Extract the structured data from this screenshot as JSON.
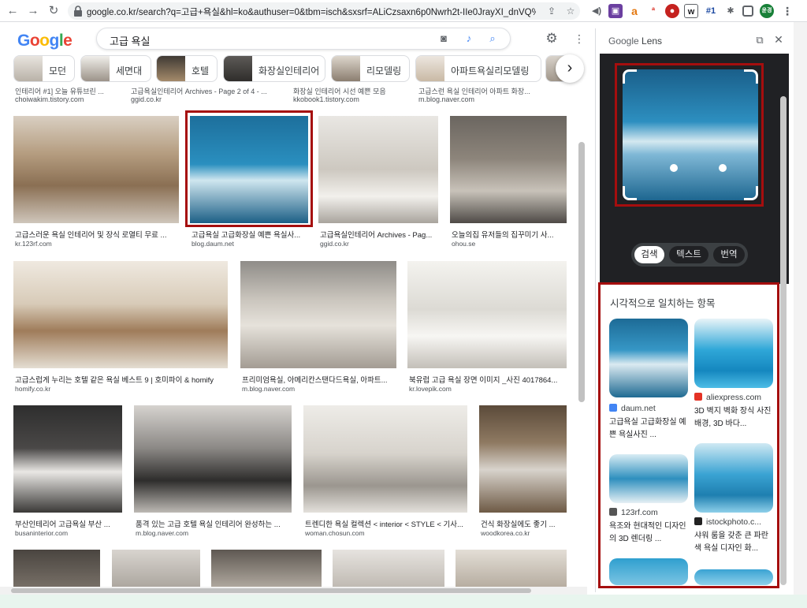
{
  "browser": {
    "url": "google.co.kr/search?q=고급+욕실&hl=ko&authuser=0&tbm=isch&sxsrf=ALiCzsaxn6p0Nwrh2t-IIe0JrayXI_dnVQ%3A16...",
    "ext_badge": "#1",
    "profile_label": "윤경"
  },
  "google": {
    "logo": "Google",
    "query": "고급 욕실",
    "chips": [
      {
        "label": "모던"
      },
      {
        "label": "세면대"
      },
      {
        "label": "호텔"
      },
      {
        "label": "화장실인테리어"
      },
      {
        "label": "리모델링"
      },
      {
        "label": "아파트욕실리모델링"
      }
    ],
    "top_row_captions": [
      {
        "caption": "인테리어 #1] 오늘 유튜브린 ...",
        "source": "choiwakim.tistory.com"
      },
      {
        "caption": "고급욕실인테리어 Archives - Page 2 of 4 - ...",
        "source": "ggid.co.kr"
      },
      {
        "caption": "화장실 인테리어 시선 예쁜 모음",
        "source": "kkobook1.tistory.com"
      },
      {
        "caption": "고급스런 욕실 인테리어 아파트 화장...",
        "source": "m.blog.naver.com"
      }
    ],
    "results": [
      {
        "caption": "고급스러운 욕실 인테리어 및 장식 로열티 무료 ...",
        "source": "kr.123rf.com"
      },
      {
        "caption": "고급욕실 고급화장실 예쁜 욕실사...",
        "source": "blog.daum.net"
      },
      {
        "caption": "고급욕실인테리어 Archives - Pag...",
        "source": "ggid.co.kr"
      },
      {
        "caption": "오늘의집 유저들의 집꾸미기 사...",
        "source": "ohou.se"
      },
      {
        "caption": "고급스럽게 누리는 호텔 같은 욕실 베스트 9 | 호미파이 & homify",
        "source": "homify.co.kr"
      },
      {
        "caption": "프리미엄욕실, 아메리칸스탠다드욕실, 아파트...",
        "source": "m.blog.naver.com"
      },
      {
        "caption": "북유럽 고급 욕실 장면 이미지 _사진 4017864...",
        "source": "kr.lovepik.com"
      },
      {
        "caption": "부산인테리어 고급욕실 부산 ...",
        "source": "busaninterior.com"
      },
      {
        "caption": "품격 있는 고급 호텔 욕실 인테리어 완성하는 ...",
        "source": "m.blog.naver.com"
      },
      {
        "caption": "트렌디한 욕실 컬렉션 < interior < STYLE < 기사...",
        "source": "woman.chosun.com"
      },
      {
        "caption": "건식 화장실에도 좋기 ...",
        "source": "woodkorea.co.kr"
      }
    ]
  },
  "lens": {
    "title_brand": "Google",
    "title_rest": " Lens",
    "segments": [
      "검색",
      "텍스트",
      "번역"
    ],
    "active_segment": "검색",
    "visual_matches_title": "시각적으로 일치하는 항목",
    "matches": [
      {
        "source": "daum.net",
        "caption": "고급욕실 고급화장실 예쁜 욕실사진 ...",
        "favicon_color": "#4285f4"
      },
      {
        "source": "aliexpress.com",
        "caption": "3D 벽지 벽화 장식 사진 배경, 3D 바다...",
        "favicon_color": "#e43225"
      },
      {
        "source": "123rf.com",
        "caption": "욕조와 현대적인 디자인의 3D 렌더링 ...",
        "favicon_color": "#555555"
      },
      {
        "source": "istockphoto.c...",
        "caption": "샤워 룸을 갖춘 큰 파란색 욕실 디자인 화...",
        "favicon_color": "#222222"
      }
    ]
  }
}
